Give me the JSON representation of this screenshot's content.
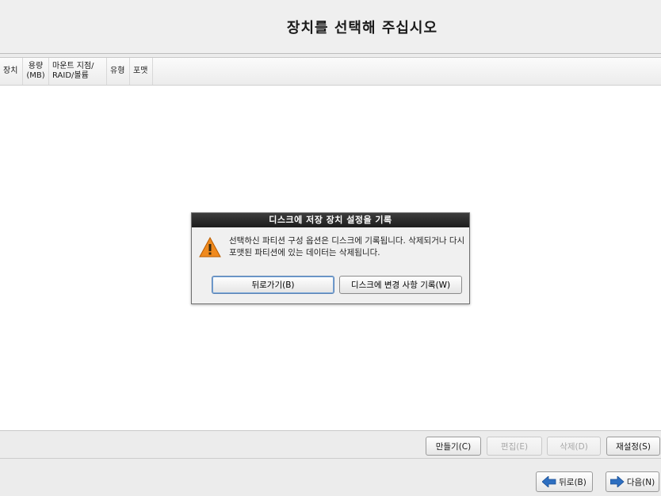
{
  "header": {
    "title": "장치를 선택해 주십시오"
  },
  "table": {
    "columns": [
      {
        "label": "장치"
      },
      {
        "line1": "용량",
        "line2": "(MB)"
      },
      {
        "line1": "마운트 지점/",
        "line2": "RAID/볼륨"
      },
      {
        "label": "유형"
      },
      {
        "label": "포맷"
      }
    ]
  },
  "dialog": {
    "title": "디스크에 저장 장치 설정을 기록",
    "message": "선택하신 파티션 구성 옵션은 디스크에 기록됩니다. 삭제되거나 다시 포맷된 파티션에 있는 데이터는 삭제됩니다.",
    "back_button": "뒤로가기(B)",
    "write_button": "디스크에 변경 사항 기록(W)",
    "icon": "warning-icon"
  },
  "actions": {
    "create": "만들기(C)",
    "edit": "편집(E)",
    "delete": "삭제(D)",
    "reset": "재설정(S)"
  },
  "nav": {
    "back": "뒤로(B)",
    "next": "다음(N)",
    "back_icon": "arrow-left-icon",
    "next_icon": "arrow-right-icon"
  },
  "colors": {
    "arrow_blue": "#2d6fc1",
    "warning_orange": "#f08a1e"
  }
}
